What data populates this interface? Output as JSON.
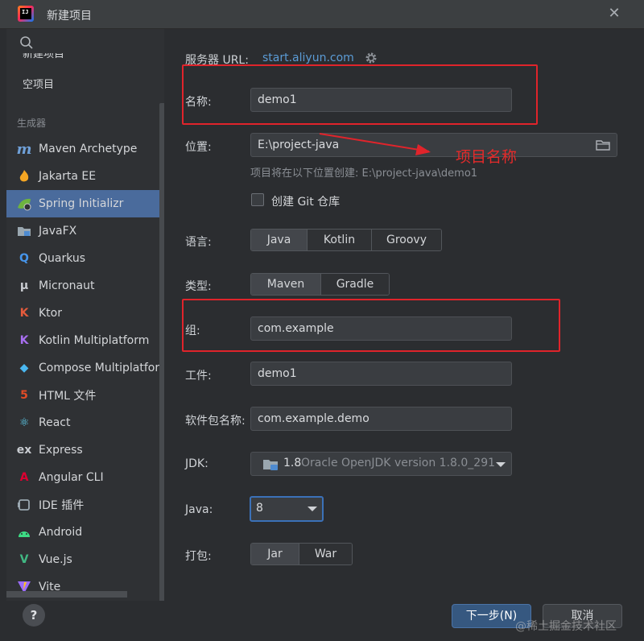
{
  "window": {
    "title": "新建项目",
    "logo_text": "IJ"
  },
  "sidebar": {
    "search_placeholder": "",
    "partial_item": "新建项目",
    "empty_project": "空项目",
    "section_label": "生成器",
    "items": [
      {
        "label": "Maven Archetype",
        "icon": "m",
        "color": "#6fa0d8"
      },
      {
        "label": "Jakarta EE",
        "icon": "flame",
        "color": "#f5a623"
      },
      {
        "label": "Spring Initializr",
        "icon": "spring",
        "color": "#6db33f"
      },
      {
        "label": "JavaFX",
        "icon": "folder",
        "color": "#9aa7b0"
      },
      {
        "label": "Quarkus",
        "icon": "Q",
        "color": "#4695eb"
      },
      {
        "label": "Micronaut",
        "icon": "μ",
        "color": "#c8cbd0"
      },
      {
        "label": "Ktor",
        "icon": "K",
        "color": "#e55b3c"
      },
      {
        "label": "Kotlin Multiplatform",
        "icon": "K",
        "color": "#a86ff0"
      },
      {
        "label": "Compose Multiplatform",
        "icon": "◆",
        "color": "#4ab7f0"
      },
      {
        "label": "HTML 文件",
        "icon": "5",
        "color": "#e34c26"
      },
      {
        "label": "React",
        "icon": "⚛",
        "color": "#61dafb"
      },
      {
        "label": "Express",
        "icon": "ex",
        "color": "#c8cbd0"
      },
      {
        "label": "Angular CLI",
        "icon": "A",
        "color": "#dd0031"
      },
      {
        "label": "IDE 插件",
        "icon": "plug",
        "color": "#9aa7b0"
      },
      {
        "label": "Android",
        "icon": "android",
        "color": "#3ddc84"
      },
      {
        "label": "Vue.js",
        "icon": "V",
        "color": "#41b883"
      },
      {
        "label": "Vite",
        "icon": "vite",
        "color": "#ffc517"
      }
    ]
  },
  "form": {
    "server_url_label": "服务器 URL:",
    "server_url": "start.aliyun.com",
    "name_label": "名称:",
    "name_value": "demo1",
    "location_label": "位置:",
    "location_value": "E:\\project-java",
    "location_hint": "项目将在以下位置创建: E:\\project-java\\demo1",
    "git_label": "创建 Git 仓库",
    "language_label": "语言:",
    "languages": [
      "Java",
      "Kotlin",
      "Groovy"
    ],
    "type_label": "类型:",
    "types": [
      "Maven",
      "Gradle"
    ],
    "group_label": "组:",
    "group_value": "com.example",
    "artifact_label": "工件:",
    "artifact_value": "demo1",
    "package_label": "软件包名称:",
    "package_value": "com.example.demo",
    "jdk_label": "JDK:",
    "jdk_version": "1.8",
    "jdk_desc": "Oracle OpenJDK version 1.8.0_291",
    "java_label": "Java:",
    "java_value": "8",
    "packaging_label": "打包:",
    "packagings": [
      "Jar",
      "War"
    ]
  },
  "buttons": {
    "next": "下一步(N)",
    "cancel": "取消",
    "help": "?"
  },
  "annotation": {
    "text": "项目名称",
    "color": "#e0242b"
  },
  "watermark": "@稀土掘金技术社区"
}
